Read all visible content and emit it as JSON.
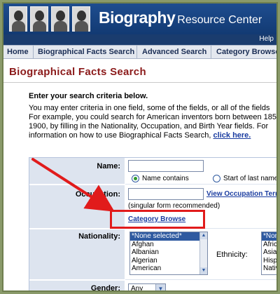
{
  "header": {
    "brand_bold": "Biography",
    "brand_rest": "Resource Center",
    "help": "Help"
  },
  "nav": {
    "items": [
      "Home",
      "Biographical Facts Search",
      "Advanced Search",
      "Category Browse"
    ]
  },
  "page": {
    "title": "Biographical Facts Search",
    "criteria_heading": "Enter your search criteria below.",
    "intro_lines": [
      "You may enter criteria in one field, some of the fields, or all of the fields",
      "For example, you could search for American inventors born between 185",
      "1900, by filling in the Nationality, Occupation, and Birth Year fields. For",
      "information on how to use Biographical Facts Search,"
    ],
    "click_here": "click here."
  },
  "form": {
    "name_label": "Name:",
    "name_value": "",
    "radio_contains": "Name contains",
    "radio_start": "Start of last name",
    "occupation_label": "Occupation:",
    "occupation_value": "",
    "occupation_hint": "(singular form recommended)",
    "view_occupation_link": "View Occupation Term",
    "category_browse_link": "Category Browse",
    "nationality_label": "Nationality:",
    "nationality_options": [
      "*None selected*",
      "Afghan",
      "Albanian",
      "Algerian",
      "American"
    ],
    "ethnicity_label": "Ethnicity:",
    "ethnicity_options": [
      "*None se",
      "Africa",
      "Asian",
      "Hispa",
      "Nativ"
    ],
    "gender_label": "Gender:",
    "gender_value": "Any"
  },
  "annotation": {
    "highlight_color": "#e11b1b",
    "target": "Category Browse"
  }
}
